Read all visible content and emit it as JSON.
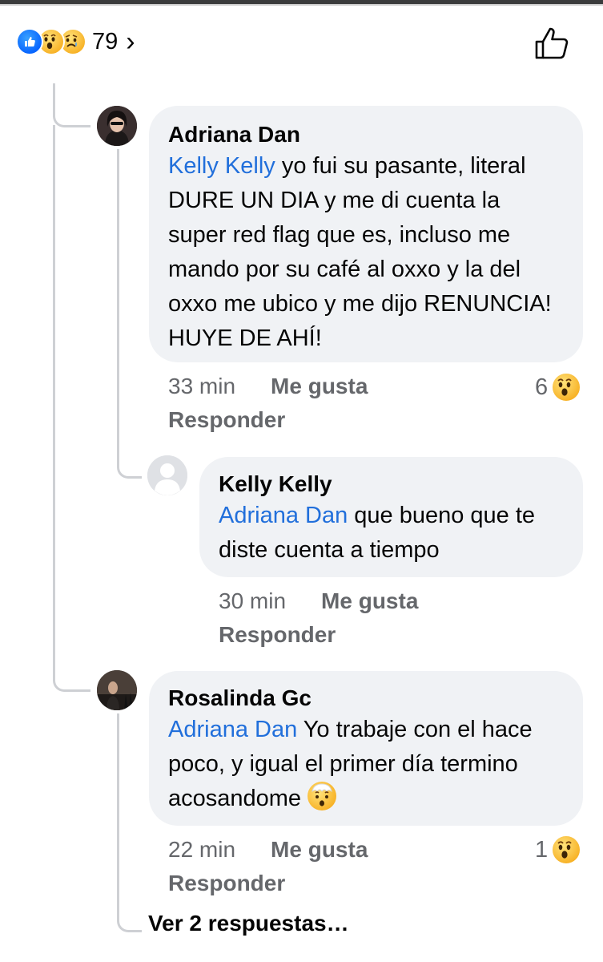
{
  "reactions": {
    "count": "79",
    "types": [
      "like-icon",
      "wow-icon",
      "sad-icon"
    ],
    "chevron": "›"
  },
  "colors": {
    "mention": "#216fdb",
    "bubble": "#f0f2f5",
    "meta": "#65676b",
    "like_blue": "#0866ff",
    "emoji_yellow": "#f7b125"
  },
  "comments": [
    {
      "author": "Adriana Dan",
      "mention": "Kelly Kelly",
      "text": " yo fui su pasante, literal DURE UN DIA y me di cuenta la super red flag que es, incluso me mando por su café al oxxo y la del oxxo me ubico y me dijo RENUNCIA! HUYE DE AHÍ!",
      "time": "33 min",
      "like_label": "Me gusta",
      "reply_label": "Responder",
      "reaction_count": "6",
      "reaction_icon": "wow-icon"
    },
    {
      "author": "Kelly Kelly",
      "mention": "Adriana Dan",
      "text": " que bueno que te diste cuenta a tiempo",
      "time": "30 min",
      "like_label": "Me gusta",
      "reply_label": "Responder"
    },
    {
      "author": "Rosalinda Gc",
      "mention": "Adriana Dan",
      "text": " Yo trabaje con el hace poco, y igual el primer día termino acosandome ",
      "trailing_icon": "exploding-head-icon",
      "time": "22 min",
      "like_label": "Me gusta",
      "reply_label": "Responder",
      "reaction_count": "1",
      "reaction_icon": "wow-icon"
    }
  ],
  "view_more_replies": "Ver 2 respuestas…"
}
